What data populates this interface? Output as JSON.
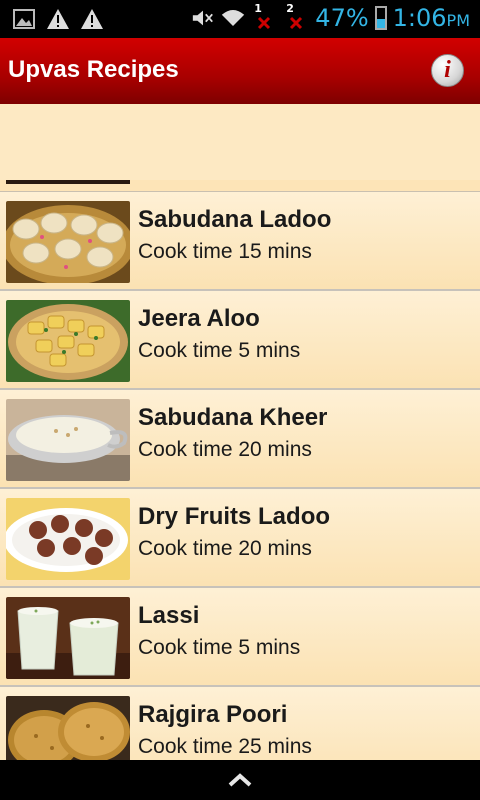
{
  "status_bar": {
    "battery_percent": "47%",
    "battery_level": 0.47,
    "time": "1:06",
    "ampm": "PM",
    "sim1": "1",
    "sim2": "2",
    "icons": [
      "picture-icon",
      "warning-icon",
      "warning-icon",
      "mute-icon",
      "wifi-icon",
      "sim-no-signal-icon",
      "sim-no-signal-icon",
      "battery-icon"
    ]
  },
  "action_bar": {
    "title": "Upvas Recipes",
    "info_label": "i"
  },
  "recipes": [
    {
      "name": "Sabudana Ladoo",
      "cook_time": "Cook time 15 mins",
      "image": "sabudana-ladoo-image"
    },
    {
      "name": "Jeera Aloo",
      "cook_time": "Cook time 5 mins",
      "image": "jeera-aloo-image"
    },
    {
      "name": "Sabudana Kheer",
      "cook_time": "Cook time 20 mins",
      "image": "sabudana-kheer-image"
    },
    {
      "name": "Dry Fruits Ladoo",
      "cook_time": "Cook time 20 mins",
      "image": "dry-fruits-ladoo-image"
    },
    {
      "name": "Lassi",
      "cook_time": "Cook time 5 mins",
      "image": "lassi-image"
    },
    {
      "name": "Rajgira Poori",
      "cook_time": "Cook time 25 mins",
      "image": "rajgira-poori-image"
    }
  ],
  "colors": {
    "action_bar": "#b00000",
    "background": "#fde9c3",
    "status_text": "#33b5e5"
  }
}
